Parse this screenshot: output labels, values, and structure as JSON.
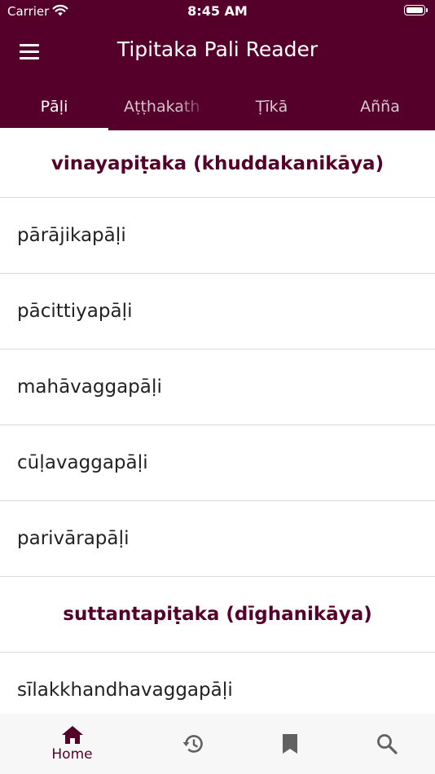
{
  "status_bar": {
    "carrier": "Carrier",
    "time": "8:45 AM"
  },
  "header": {
    "title": "Tipitaka Pali Reader"
  },
  "tabs": [
    {
      "label": "Pāḷi",
      "active": true
    },
    {
      "label": "Aṭṭhakathā",
      "active": false
    },
    {
      "label": "Ṭīkā",
      "active": false
    },
    {
      "label": "Añña",
      "active": false
    }
  ],
  "list": {
    "section1": "vinayapiṭaka (khuddakanikāya)",
    "items1": [
      "pārājikapāḷi",
      "pācittiyapāḷi",
      "mahāvaggapāḷi",
      "cūḷavaggapāḷi",
      "parivārapāḷi"
    ],
    "section2": "suttantapiṭaka (dīghanikāya)",
    "items2": [
      "sīlakkhandhavaggapāḷi"
    ]
  },
  "bottom_nav": {
    "items": [
      {
        "icon": "home-icon",
        "label": "Home",
        "active": true
      },
      {
        "icon": "history-icon"
      },
      {
        "icon": "bookmark-icon"
      },
      {
        "icon": "search-icon"
      }
    ]
  },
  "colors": {
    "primary": "#54002a",
    "nav_inactive": "#616161"
  }
}
